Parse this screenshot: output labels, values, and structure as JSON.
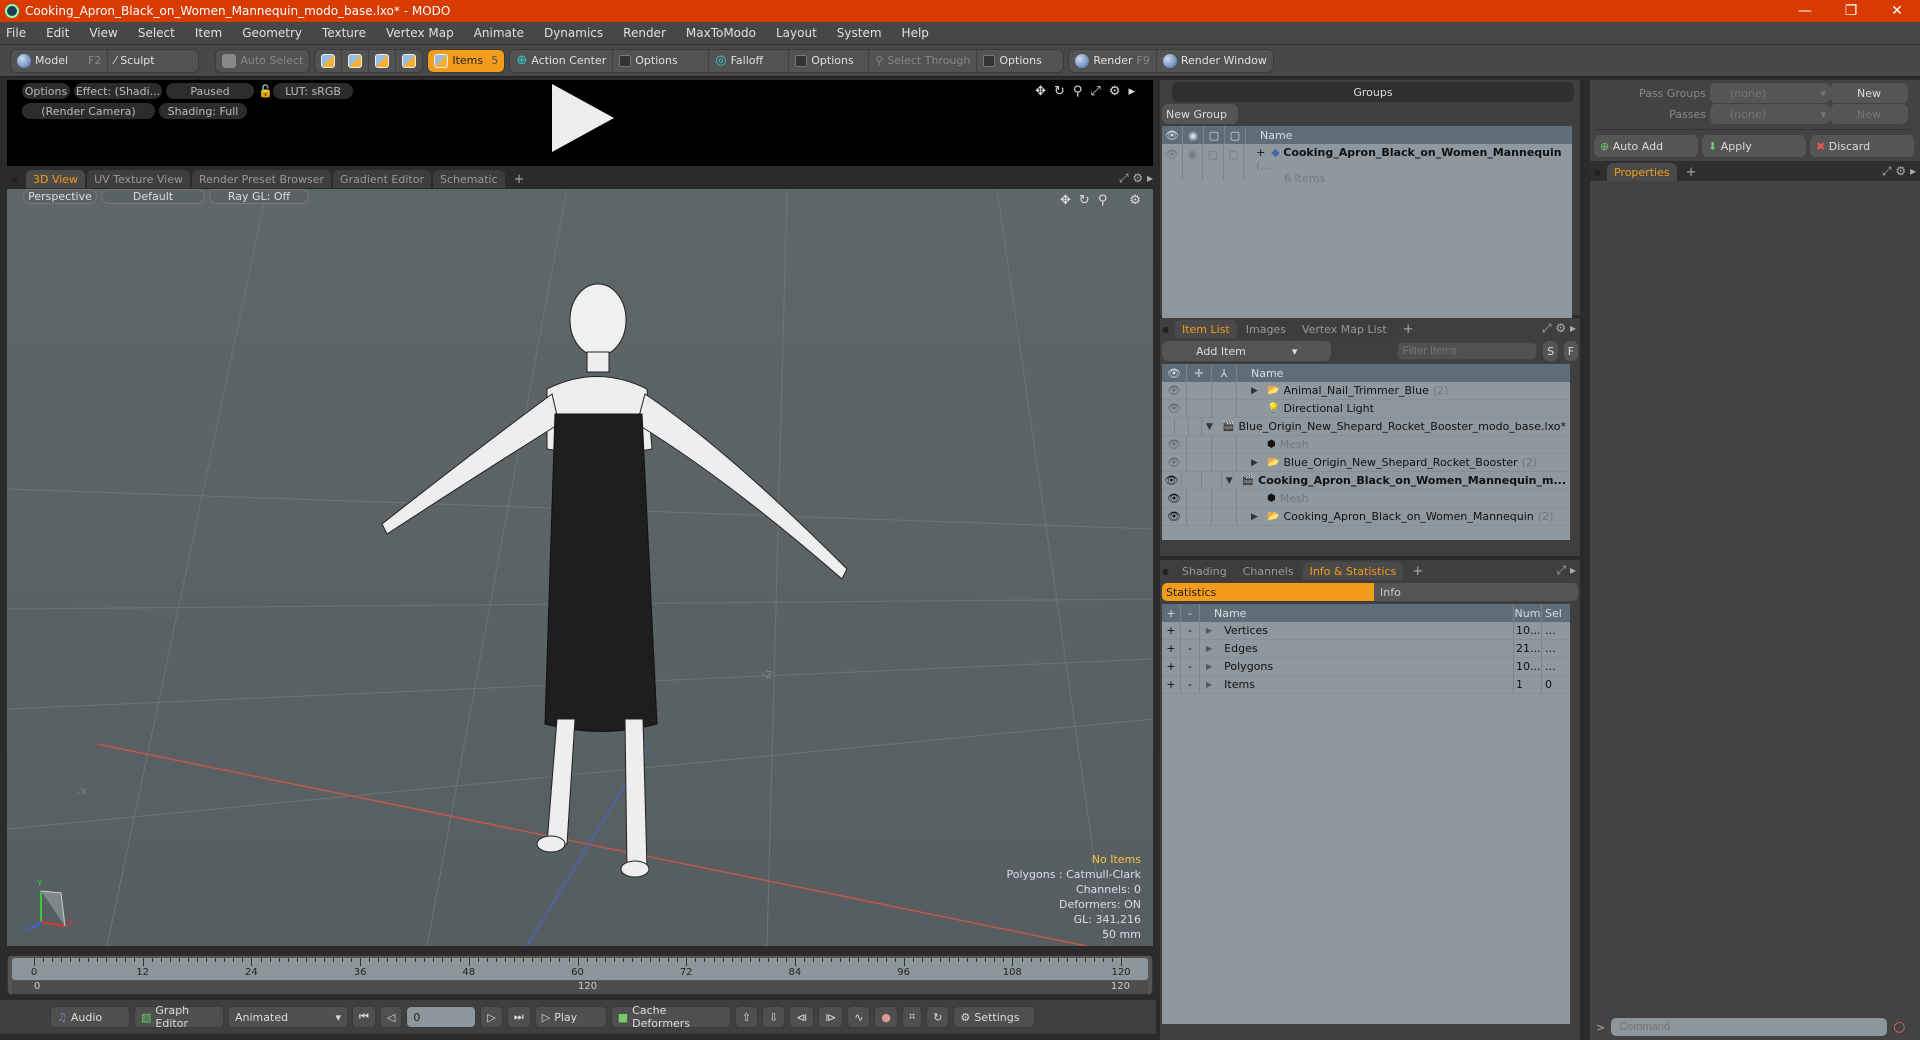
{
  "window": {
    "title": "Cooking_Apron_Black_on_Women_Mannequin_modo_base.lxo* - MODO",
    "controls": {
      "minimize": "—",
      "restore": "❐",
      "close": "✕"
    }
  },
  "menu": [
    "File",
    "Edit",
    "View",
    "Select",
    "Item",
    "Geometry",
    "Texture",
    "Vertex Map",
    "Animate",
    "Dynamics",
    "Render",
    "MaxToModo",
    "Layout",
    "System",
    "Help"
  ],
  "toolbar": {
    "model": "Model",
    "model_key": "F2",
    "sculpt": "Sculpt",
    "auto_select": "Auto Select",
    "items": "Items",
    "items_key": "5",
    "action_center": "Action Center",
    "options1": "Options",
    "falloff": "Falloff",
    "options2": "Options",
    "select_through": "Select Through",
    "options3": "Options",
    "render": "Render",
    "render_key": "F9",
    "render_window": "Render Window"
  },
  "preview": {
    "options": "Options",
    "effect": "Effect: (Shadi...",
    "paused": "Paused",
    "lut": "LUT: sRGB",
    "camera": "(Render Camera)",
    "shading": "Shading: Full"
  },
  "viewport_tabs": [
    "3D View",
    "UV Texture View",
    "Render Preset Browser",
    "Gradient Editor",
    "Schematic"
  ],
  "viewport": {
    "perspective": "Perspective",
    "default": "Default",
    "raygl": "Ray GL: Off",
    "info": {
      "selection": "No Items",
      "polygons": "Polygons : Catmull-Clark",
      "channels": "Channels: 0",
      "deformers": "Deformers: ON",
      "gl": "GL: 341,216",
      "lens": "50 mm"
    },
    "axis": {
      "x": "X",
      "y": "Y",
      "z": "Z"
    }
  },
  "timeline": {
    "ticks": [
      "0",
      "12",
      "24",
      "36",
      "48",
      "60",
      "72",
      "84",
      "96",
      "108",
      "120"
    ],
    "range_start": "0",
    "range_mid": "120",
    "range_end": "120"
  },
  "transport": {
    "audio": "Audio",
    "graph_editor": "Graph Editor",
    "animated": "Animated",
    "frame": "0",
    "play": "Play",
    "cache_deformers": "Cache Deformers",
    "settings": "Settings"
  },
  "groups": {
    "title": "Groups",
    "new_group": "New Group",
    "name_header": "Name",
    "item_name": "Cooking_Apron_Black_on_Women_Mannequin",
    "item_suffix": "(...",
    "item_count": "6 Items"
  },
  "item_list": {
    "tabs": [
      "Item List",
      "Images",
      "Vertex Map List"
    ],
    "add_item": "Add Item",
    "filter_placeholder": "Filter Items",
    "s": "S",
    "f": "F",
    "name_header": "Name",
    "rows": [
      {
        "name": "Animal_Nail_Trimmer_Blue",
        "count": "(2)",
        "indent": 2,
        "type": "folder",
        "expander": "▶",
        "eye": "dim"
      },
      {
        "name": "Directional Light",
        "count": "",
        "indent": 2,
        "type": "light",
        "expander": "",
        "eye": "dim"
      },
      {
        "name": "Blue_Origin_New_Shepard_Rocket_Booster_modo_base.lxo*",
        "count": "",
        "indent": 1,
        "type": "scene",
        "expander": "▼",
        "eye": "none"
      },
      {
        "name": "Mesh",
        "count": "",
        "indent": 2,
        "type": "mesh",
        "expander": "",
        "eye": "dim",
        "muted": true
      },
      {
        "name": "Blue_Origin_New_Shepard_Rocket_Booster",
        "count": "(2)",
        "indent": 2,
        "type": "folder",
        "expander": "▶",
        "eye": "dim"
      },
      {
        "name": "Cooking_Apron_Black_on_Women_Mannequin_m...",
        "count": "",
        "indent": 1,
        "type": "scene",
        "expander": "▼",
        "eye": "on",
        "bold": true
      },
      {
        "name": "Mesh",
        "count": "",
        "indent": 2,
        "type": "mesh",
        "expander": "",
        "eye": "on",
        "muted": true
      },
      {
        "name": "Cooking_Apron_Black_on_Women_Mannequin",
        "count": "(2)",
        "indent": 2,
        "type": "folder",
        "expander": "▶",
        "eye": "on"
      }
    ]
  },
  "stats": {
    "tabs": [
      "Shading",
      "Channels",
      "Info & Statistics"
    ],
    "subtabs": [
      "Statistics",
      "Info"
    ],
    "headers": {
      "plus": "+",
      "minus": "-",
      "name": "Name",
      "num": "Num",
      "sel": "Sel"
    },
    "rows": [
      {
        "name": "Vertices",
        "num": "10...",
        "sel": "..."
      },
      {
        "name": "Edges",
        "num": "21...",
        "sel": "..."
      },
      {
        "name": "Polygons",
        "num": "10...",
        "sel": "..."
      },
      {
        "name": "Items",
        "num": "1",
        "sel": "0"
      }
    ]
  },
  "passes": {
    "pass_groups": "Pass Groups",
    "passes": "Passes",
    "none": "(none)",
    "new": "New",
    "auto_add": "Auto Add",
    "apply": "Apply",
    "discard": "Discard"
  },
  "properties": {
    "tab": "Properties"
  },
  "command": {
    "placeholder": "Command",
    "prompt": ">"
  }
}
